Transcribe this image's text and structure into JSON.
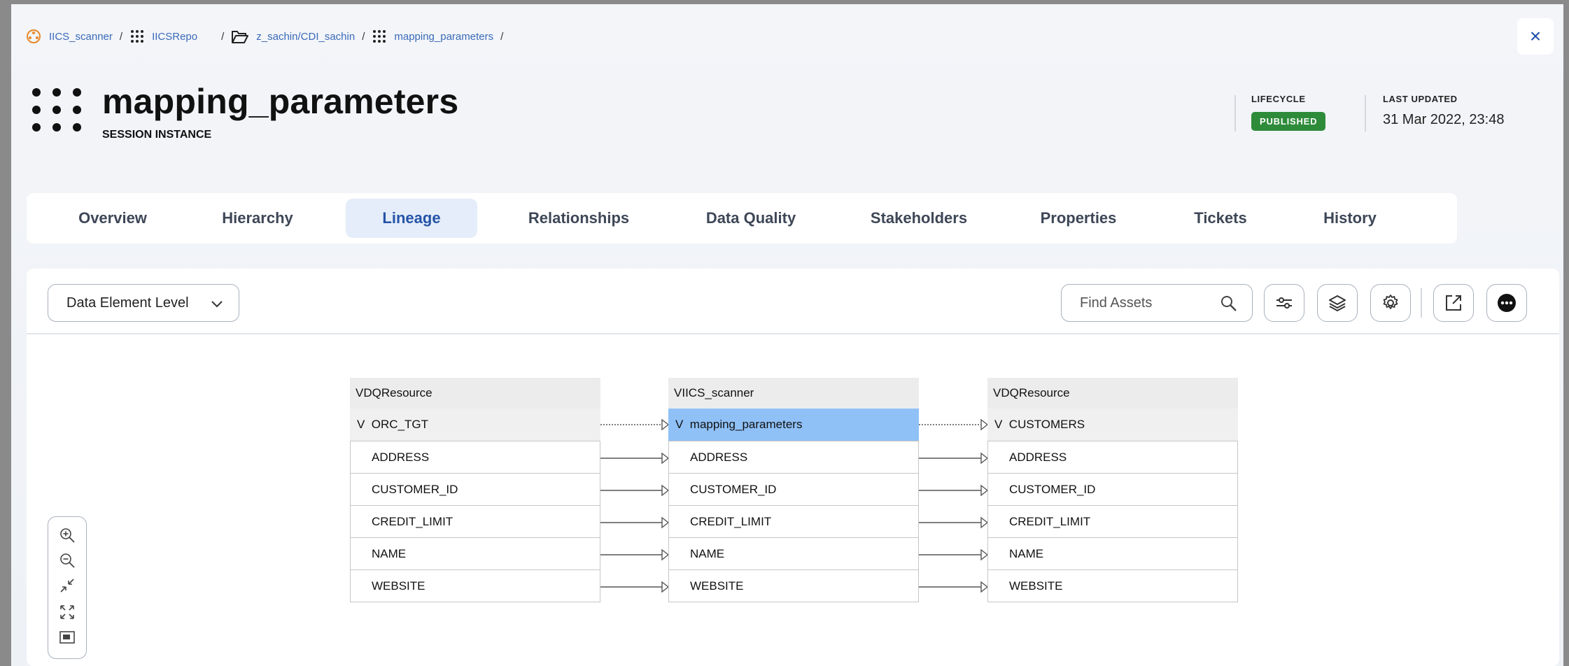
{
  "breadcrumb": {
    "items": [
      {
        "label": "IICS_scanner",
        "icon": "scanner-icon"
      },
      {
        "label": "IICSRepo",
        "icon": "grid-dots-icon"
      },
      {
        "label": "z_sachin/CDI_sachin",
        "icon": "folder-open-icon"
      },
      {
        "label": "mapping_parameters",
        "icon": "grid-dots-icon"
      }
    ],
    "separator": "/"
  },
  "close_label": "×",
  "header": {
    "title": "mapping_parameters",
    "subtitle": "SESSION INSTANCE",
    "lifecycle_label": "LIFECYCLE",
    "lifecycle_status": "PUBLISHED",
    "last_updated_label": "LAST UPDATED",
    "last_updated_value": "31 Mar 2022, 23:48"
  },
  "tabs": [
    {
      "label": "Overview",
      "active": false
    },
    {
      "label": "Hierarchy",
      "active": false
    },
    {
      "label": "Lineage",
      "active": true
    },
    {
      "label": "Relationships",
      "active": false
    },
    {
      "label": "Data Quality",
      "active": false
    },
    {
      "label": "Stakeholders",
      "active": false
    },
    {
      "label": "Properties",
      "active": false
    },
    {
      "label": "Tickets",
      "active": false
    },
    {
      "label": "History",
      "active": false
    }
  ],
  "toolbar": {
    "level_select": "Data Element Level",
    "search_placeholder": "Find Assets",
    "buttons": [
      "filter-sliders-icon",
      "layers-icon",
      "settings-gear-icon",
      "open-external-icon",
      "more-options-icon"
    ]
  },
  "lineage": {
    "nodes": [
      {
        "header": "DQResource",
        "group": "ORC_TGT",
        "selected": false,
        "fields": [
          "ADDRESS",
          "CUSTOMER_ID",
          "CREDIT_LIMIT",
          "NAME",
          "WEBSITE"
        ]
      },
      {
        "header": "IICS_scanner",
        "group": "mapping_parameters",
        "selected": true,
        "fields": [
          "ADDRESS",
          "CUSTOMER_ID",
          "CREDIT_LIMIT",
          "NAME",
          "WEBSITE"
        ]
      },
      {
        "header": "DQResource",
        "group": "CUSTOMERS",
        "selected": false,
        "fields": [
          "ADDRESS",
          "CUSTOMER_ID",
          "CREDIT_LIMIT",
          "NAME",
          "WEBSITE"
        ]
      }
    ],
    "expand_glyph": "V"
  },
  "zoom_controls": [
    "zoom-in-icon",
    "zoom-out-icon",
    "collapse-icon",
    "fit-screen-icon",
    "minimap-icon"
  ],
  "colors": {
    "accent": "#2553a7",
    "published": "#2e8b3a",
    "selected_node": "#8fc1f7",
    "link": "#3a6ab8"
  }
}
